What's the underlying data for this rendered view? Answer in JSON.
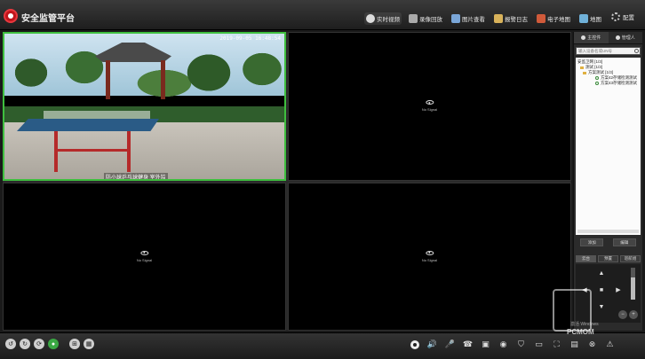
{
  "app": {
    "title": "安全监管平台"
  },
  "nav": [
    {
      "label": "实时视频",
      "icon": "live-view-icon",
      "active": true
    },
    {
      "label": "录像回放",
      "icon": "playback-icon"
    },
    {
      "label": "图片查看",
      "icon": "picture-icon"
    },
    {
      "label": "报警日志",
      "icon": "alarm-log-icon"
    },
    {
      "label": "电子地图",
      "icon": "e-map-icon"
    },
    {
      "label": "地图",
      "icon": "map-icon"
    }
  ],
  "config_label": "配置",
  "tiles": {
    "cam1": {
      "timestamp": "2019-09-05 16:48:54",
      "caption": "防小球乒乓球健身 室外监"
    },
    "no_signal": "No Signal"
  },
  "panel": {
    "tabs": [
      "主控件",
      "管理人"
    ],
    "search_placeholder": "输入设备名或UN号",
    "tree": [
      {
        "label": "安监卫网 [1/3]",
        "level": 0,
        "type": "root"
      },
      {
        "label": "测试 [1/3]",
        "level": 1,
        "type": "folder"
      },
      {
        "label": "方案测试 [1/3]",
        "level": 2,
        "type": "folder"
      },
      {
        "label": "方案42存储检测测试",
        "level": 3,
        "type": "camera"
      },
      {
        "label": "方案43存储检测测试",
        "level": 3,
        "type": "camera"
      }
    ],
    "buttons": [
      "添加",
      "编辑"
    ],
    "ptz_tabs": [
      "云台",
      "预置",
      "巡航组"
    ],
    "zoom_level": 0.7
  },
  "watermark": {
    "text": "PCMOM",
    "small": "激活 Windows"
  }
}
